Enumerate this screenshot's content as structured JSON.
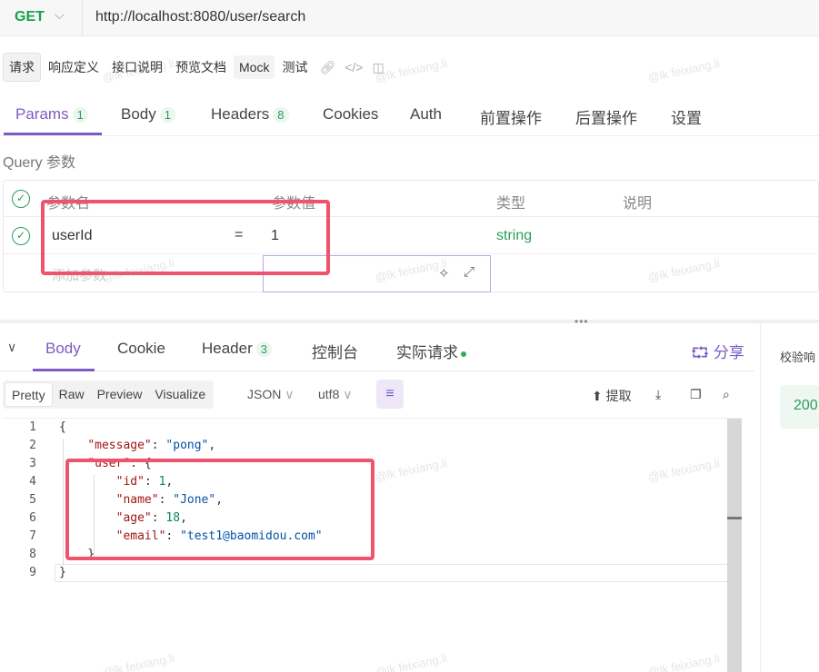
{
  "url_bar": {
    "method": "GET",
    "url": "http://localhost:8080/user/search"
  },
  "subtoolbar": {
    "items": [
      "请求",
      "响应定义",
      "接口说明",
      "预览文档",
      "Mock",
      "测试"
    ],
    "icons": [
      "link-icon",
      "code-icon",
      "split-view-icon"
    ]
  },
  "request_tabs": [
    {
      "label": "Params",
      "count": "1"
    },
    {
      "label": "Body",
      "count": "1"
    },
    {
      "label": "Headers",
      "count": "8"
    },
    {
      "label": "Cookies"
    },
    {
      "label": "Auth"
    },
    {
      "label": "前置操作"
    },
    {
      "label": "后置操作"
    },
    {
      "label": "设置"
    }
  ],
  "query_label": "Query 参数",
  "params_table": {
    "headers": [
      "参数名",
      "参数值",
      "类型",
      "说明"
    ],
    "rows": [
      {
        "name": "userId",
        "eq": "=",
        "value": "1",
        "type": "string",
        "desc": ""
      }
    ],
    "add_placeholder": "添加参数"
  },
  "response_tabs": [
    {
      "label": "Body"
    },
    {
      "label": "Cookie"
    },
    {
      "label": "Header",
      "count": "3"
    },
    {
      "label": "控制台"
    },
    {
      "label": "实际请求"
    }
  ],
  "share_label": "分享",
  "side_panel": {
    "label": "校验响",
    "status": "200"
  },
  "view_modes": [
    "Pretty",
    "Raw",
    "Preview",
    "Visualize"
  ],
  "format_select": "JSON",
  "encoding_select": "utf8",
  "extract_label": "提取",
  "code": {
    "line_numbers": [
      "1",
      "2",
      "3",
      "4",
      "5",
      "6",
      "7",
      "8",
      "9"
    ],
    "lines": [
      "{",
      "    \"message\": \"pong\",",
      "    \"user\": {",
      "        \"id\": 1,",
      "        \"name\": \"Jone\",",
      "        \"age\": 18,",
      "        \"email\": \"test1@baomidou.com\"",
      "    }",
      "}"
    ],
    "json": {
      "message": "pong",
      "user": {
        "id": "1",
        "name": "Jone",
        "age": "18",
        "email": "test1@baomidou.com"
      }
    }
  },
  "watermark": "@lk feixiang.li",
  "colors": {
    "accent": "#7c5cc4",
    "green": "#2e9d5b",
    "highlight": "#f0546c"
  }
}
